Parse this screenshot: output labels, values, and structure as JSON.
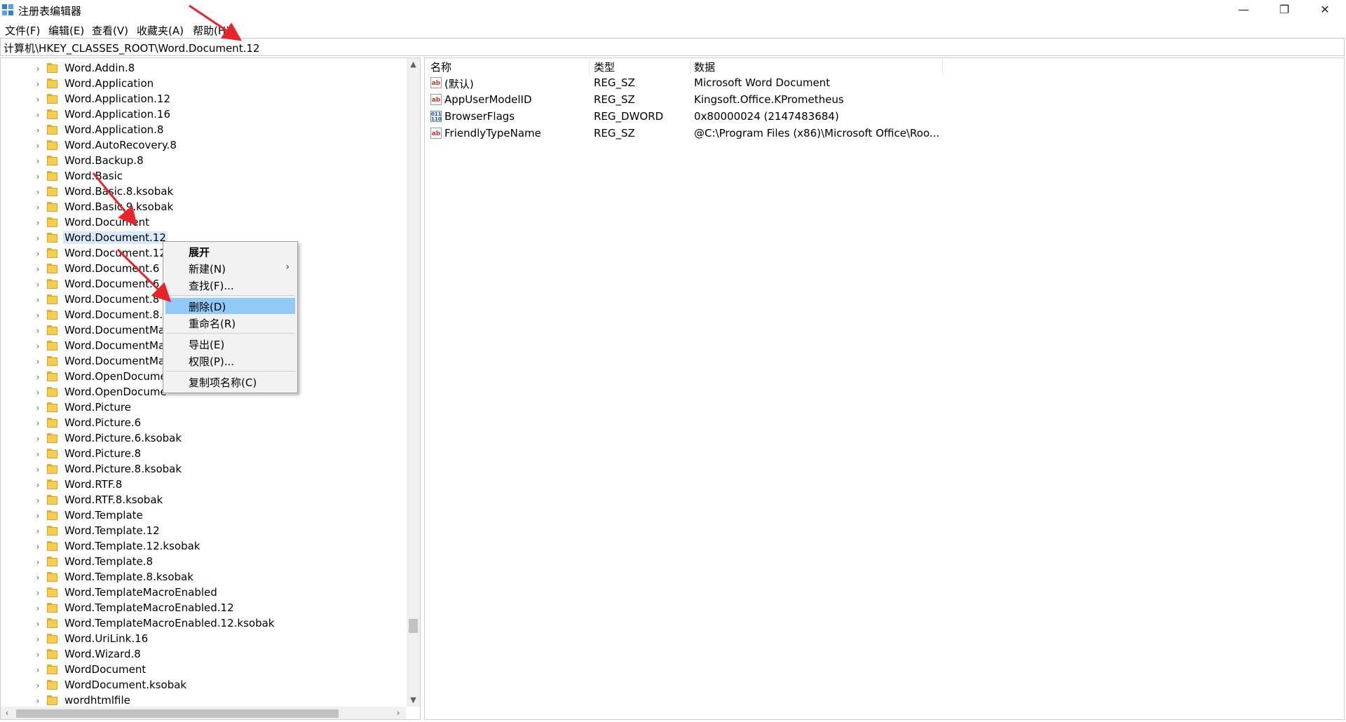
{
  "window": {
    "title": "注册表编辑器",
    "minimize_glyph": "—",
    "maximize_glyph": "❐",
    "close_glyph": "✕"
  },
  "menu": [
    "文件(F)",
    "编辑(E)",
    "查看(V)",
    "收藏夹(A)",
    "帮助(H)"
  ],
  "address": {
    "path": "计算机\\HKEY_CLASSES_ROOT\\Word.Document.12"
  },
  "tree": {
    "selected": "Word.Document.12",
    "items": [
      "Word.Addin.8",
      "Word.Application",
      "Word.Application.12",
      "Word.Application.16",
      "Word.Application.8",
      "Word.AutoRecovery.8",
      "Word.Backup.8",
      "Word.Basic",
      "Word.Basic.8.ksobak",
      "Word.Basic.9.ksobak",
      "Word.Document",
      "Word.Document.12",
      "Word.Document.12",
      "Word.Document.6",
      "Word.Document.6.l",
      "Word.Document.8",
      "Word.Document.8.l",
      "Word.DocumentMa",
      "Word.DocumentMa",
      "Word.DocumentMa",
      "Word.OpenDocume",
      "Word.OpenDocume",
      "Word.Picture",
      "Word.Picture.6",
      "Word.Picture.6.ksobak",
      "Word.Picture.8",
      "Word.Picture.8.ksobak",
      "Word.RTF.8",
      "Word.RTF.8.ksobak",
      "Word.Template",
      "Word.Template.12",
      "Word.Template.12.ksobak",
      "Word.Template.8",
      "Word.Template.8.ksobak",
      "Word.TemplateMacroEnabled",
      "Word.TemplateMacroEnabled.12",
      "Word.TemplateMacroEnabled.12.ksobak",
      "Word.UriLink.16",
      "Word.Wizard.8",
      "WordDocument",
      "WordDocument.ksobak",
      "wordhtmlfile"
    ],
    "chevron_glyph": "›",
    "scroll_up_glyph": "▲",
    "scroll_down_glyph": "▼",
    "scroll_left_glyph": "‹",
    "scroll_right_glyph": "›"
  },
  "values": {
    "columns": [
      "名称",
      "类型",
      "数据"
    ],
    "rows": [
      {
        "icon": "string-value-icon",
        "icon_text": "ab",
        "name": "(默认)",
        "type": "REG_SZ",
        "data": "Microsoft Word Document"
      },
      {
        "icon": "string-value-icon",
        "icon_text": "ab",
        "name": "AppUserModelID",
        "type": "REG_SZ",
        "data": "Kingsoft.Office.KPrometheus"
      },
      {
        "icon": "binary-value-icon",
        "icon_text": "011 110",
        "name": "BrowserFlags",
        "type": "REG_DWORD",
        "data": "0x80000024 (2147483684)"
      },
      {
        "icon": "string-value-icon",
        "icon_text": "ab",
        "name": "FriendlyTypeName",
        "type": "REG_SZ",
        "data": "@C:\\Program Files (x86)\\Microsoft Office\\Roo..."
      }
    ]
  },
  "context_menu": {
    "expand": "展开",
    "new": "新建(N)",
    "find": "查找(F)...",
    "delete": "删除(D)",
    "rename": "重命名(R)",
    "export": "导出(E)",
    "permissions": "权限(P)...",
    "copy_key_name": "复制项名称(C)",
    "submenu_glyph": "›",
    "highlighted": "删除(D)"
  },
  "colors": {
    "annotation_arrow": "#e8242a",
    "context_highlight": "#91c9f7",
    "tree_selection": "#d9e8fb",
    "folder": "#f6cd4f"
  }
}
